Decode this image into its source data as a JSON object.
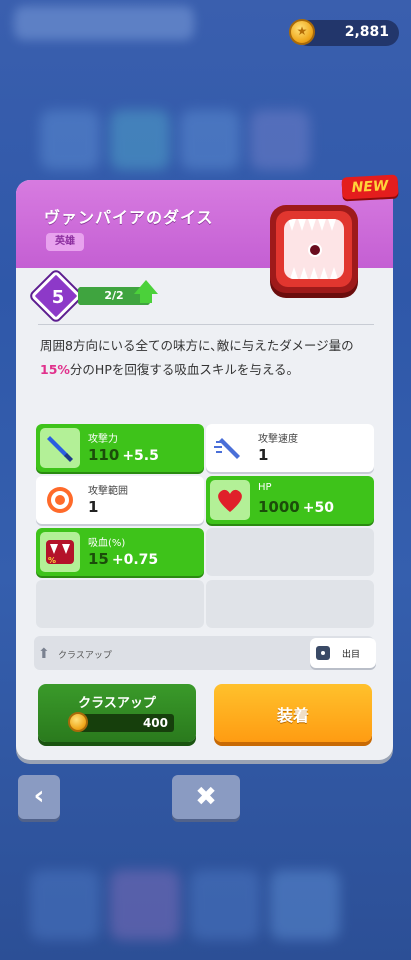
{
  "currency": {
    "coins": "2,881",
    "icon": "gold-coin-icon"
  },
  "item": {
    "name": "ヴァンパイアのダイス",
    "rarity": "英雄",
    "badge": "NEW",
    "level": "5",
    "level_progress_text": "2/2",
    "level_progress_fraction": 1.0,
    "description_parts": [
      "周囲8方向にいる全ての味方に､敵に与えたダメージ量の",
      "15%",
      "分のHPを回復する吸血スキルを与える。"
    ]
  },
  "stats": [
    {
      "label": "攻撃力",
      "value": "110",
      "bonus": "+5.5",
      "style": "green",
      "icon": "sword-icon"
    },
    {
      "label": "攻撃速度",
      "value": "1",
      "bonus": "",
      "style": "white",
      "icon": "attack-speed-icon"
    },
    {
      "label": "攻撃範囲",
      "value": "1",
      "bonus": "",
      "style": "white",
      "icon": "target-icon"
    },
    {
      "label": "HP",
      "value": "1000",
      "bonus": "+50",
      "style": "green",
      "icon": "heart-icon"
    },
    {
      "label": "吸血(%)",
      "value": "15",
      "bonus": "+0.75",
      "style": "green",
      "icon": "vampire-fangs-icon"
    }
  ],
  "hint": {
    "text": "クラスアップ"
  },
  "origin_button": {
    "label": "出目"
  },
  "class_up_button": {
    "label": "クラスアップ",
    "cost": "400"
  },
  "equip_button": {
    "label": "装着"
  },
  "colors": {
    "header": "#c45fd3",
    "green": "#3ec31a",
    "orange": "#ff9c12",
    "highlight": "#e0318c"
  }
}
